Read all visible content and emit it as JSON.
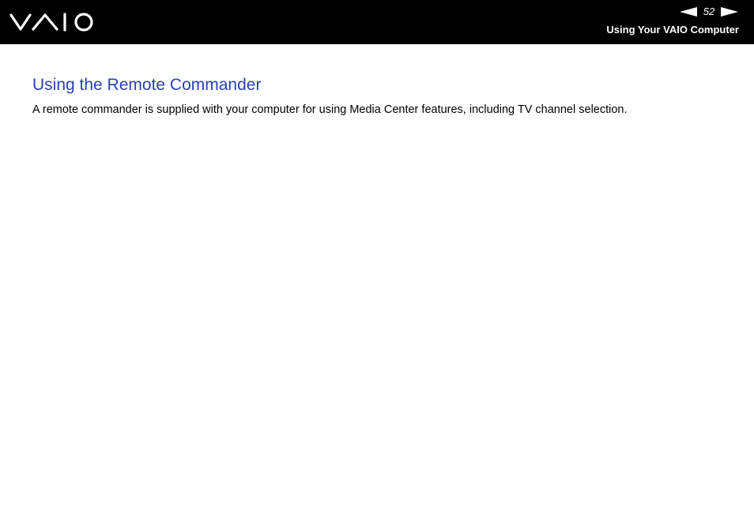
{
  "header": {
    "logo_text": "VAIO",
    "page_number": "52",
    "section_title": "Using Your VAIO Computer",
    "prev_icon": "triangle-left-icon",
    "next_icon": "triangle-right-icon"
  },
  "content": {
    "heading": "Using the Remote Commander",
    "paragraph": "A remote commander is supplied with your computer for using Media Center features, including TV channel selection."
  },
  "colors": {
    "header_background": "#000000",
    "header_text": "#ffffff",
    "heading": "#2a3fb5",
    "body_text": "#000000"
  }
}
